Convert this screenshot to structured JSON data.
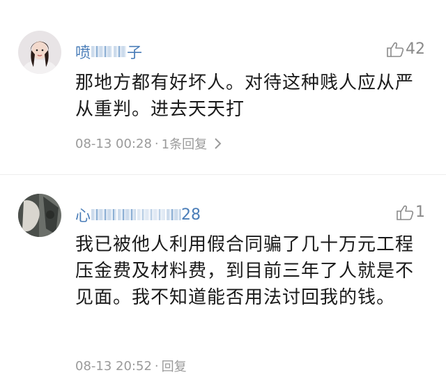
{
  "comments": [
    {
      "username_start": "喷",
      "username_end": "子",
      "likes": "42",
      "text": "那地方都有好坏人。对待这种贱人应从严从重判。进去天天打",
      "time": "08-13 00:28",
      "separator": "·",
      "reply_label": "1条回复"
    },
    {
      "username_start": "心",
      "username_end": "28",
      "likes": "1",
      "text": "我已被他人利用假合同骗了几十万元工程压金费及材料费，到目前三年了人就是不见面。我不知道能否用法讨回我的钱。",
      "time": "08-13 20:52",
      "separator": "·",
      "reply_label": "回复"
    }
  ],
  "icons": {
    "like": "thumbs-up-icon",
    "chevron": "chevron-right-icon"
  },
  "colors": {
    "username": "#4a7db8",
    "meta": "#9a9a9a",
    "text": "#1a1a1a"
  }
}
